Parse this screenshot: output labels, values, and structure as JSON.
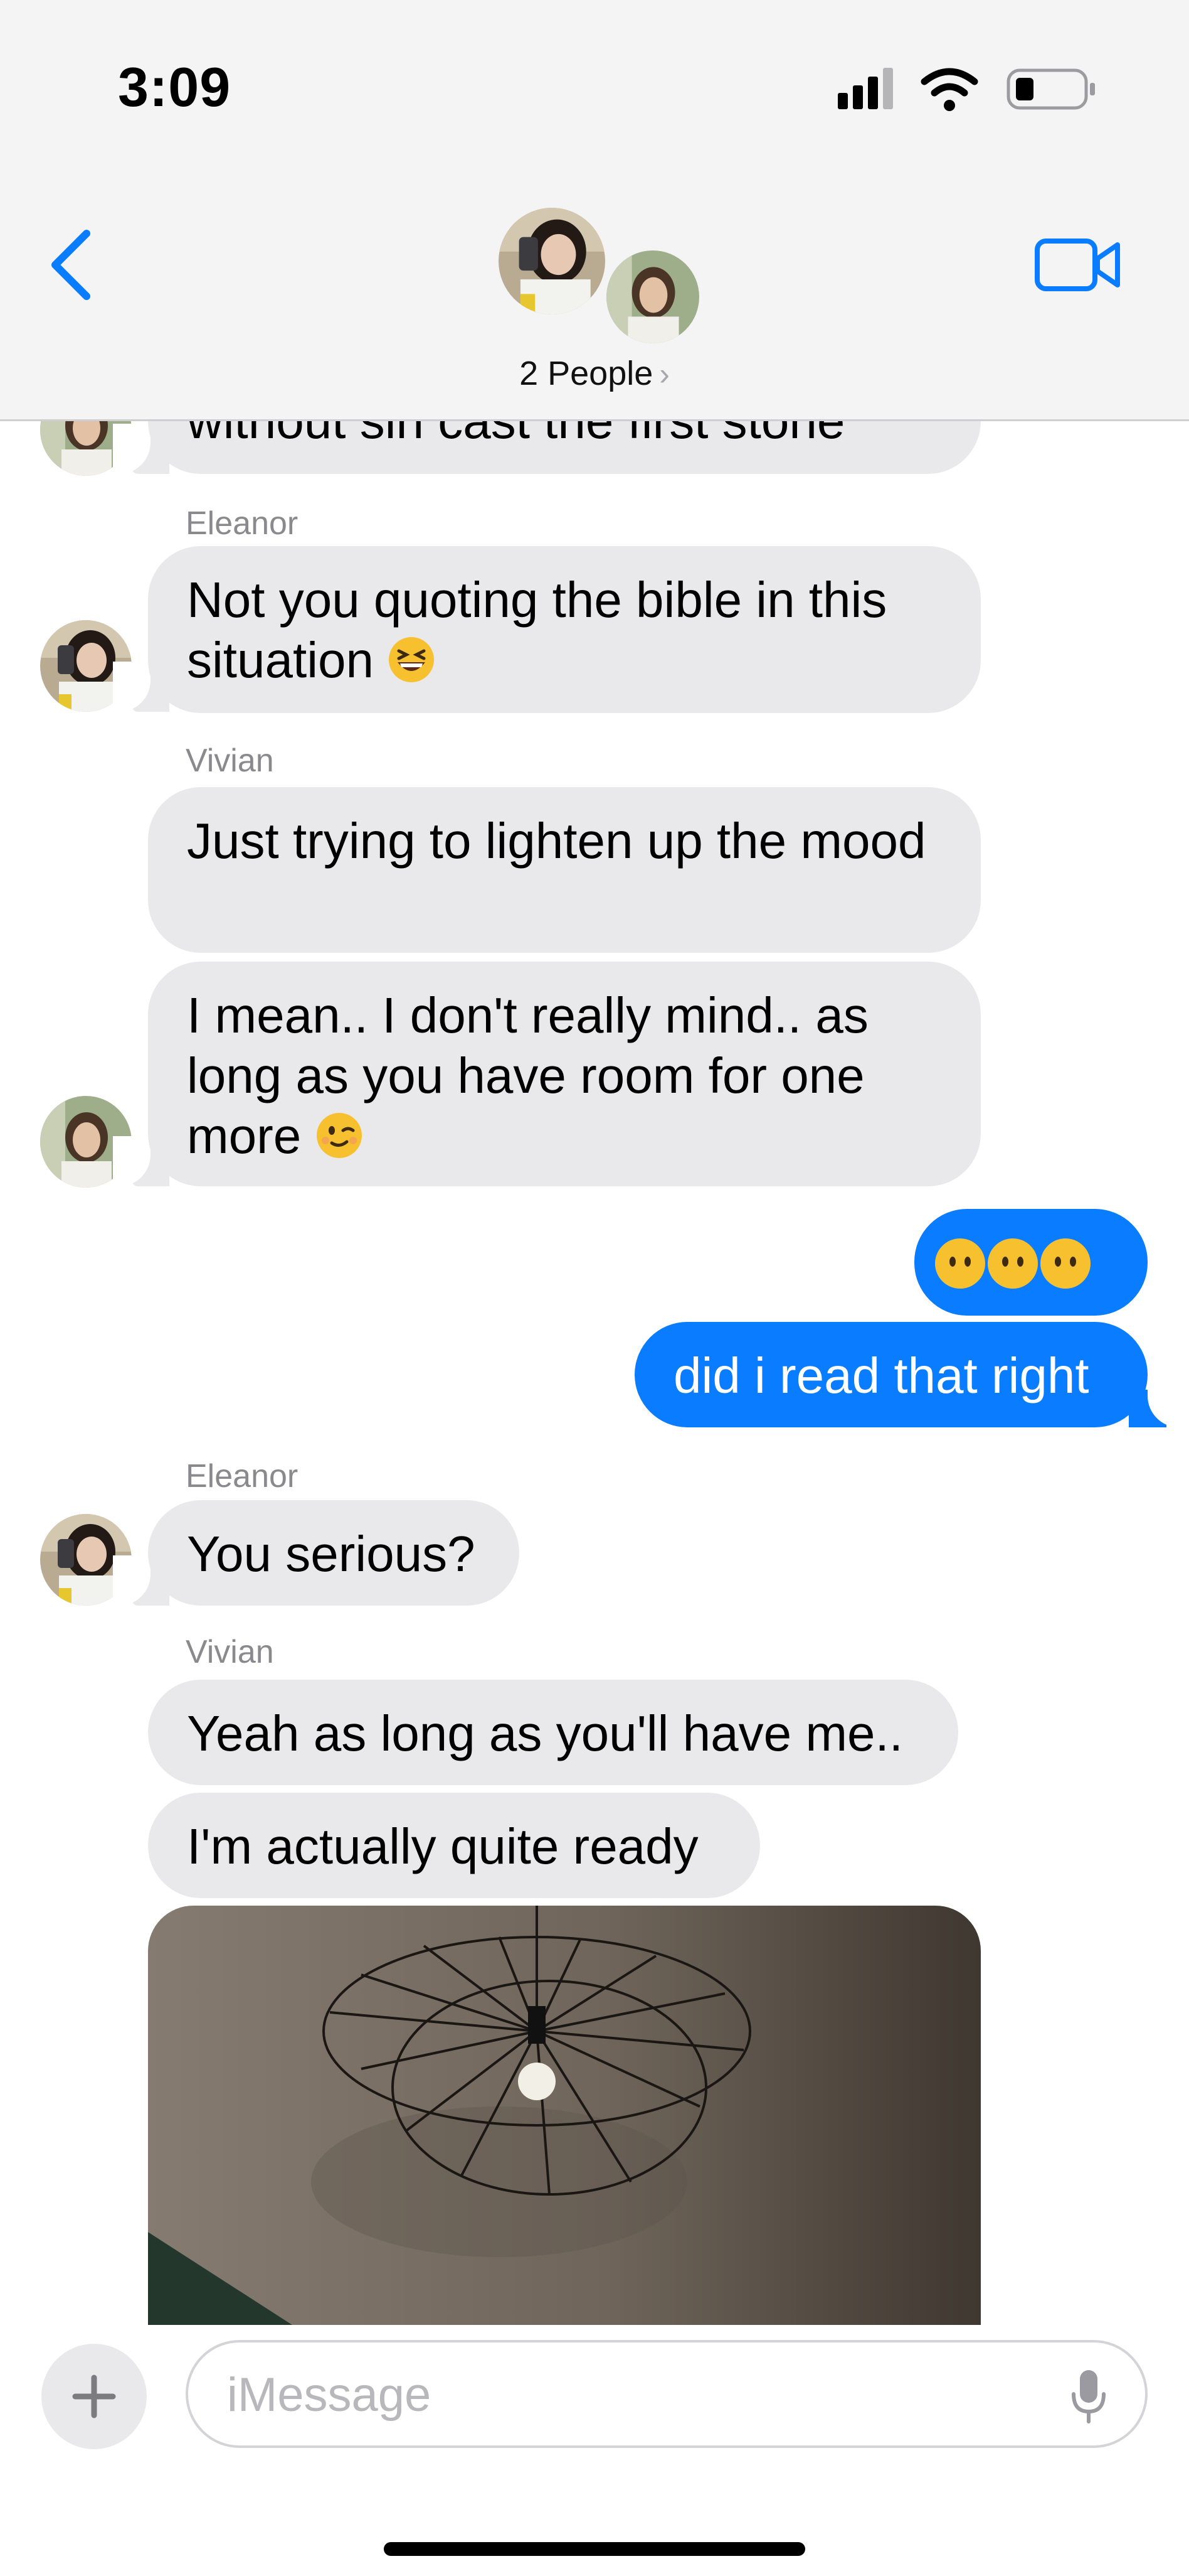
{
  "status_bar": {
    "time": "3:09"
  },
  "header": {
    "people_label": "2 People",
    "chevron": "›"
  },
  "messages": {
    "partial_top": "without sin cast the first stone",
    "m1_sender": "Eleanor",
    "m1_text": "Not you quoting the bible in this situation",
    "m2_sender": "Vivian",
    "m2_text": "Just trying to lighten up the mood",
    "m3_line1": "I mean.. I don't really mind.. as",
    "m3_line2": "long as you have room for one",
    "m3_line3": "more",
    "m4_emoji_count": 3,
    "m5_text": "did i read that right",
    "m6_sender": "Eleanor",
    "m6_text": "You serious?",
    "m7_sender": "Vivian",
    "m7_text": "Yeah as long as you'll have me..",
    "m8_text": "I'm actually quite ready"
  },
  "input": {
    "placeholder": "iMessage"
  },
  "icons": {
    "back": "chevron-left-icon",
    "video": "video-camera-icon",
    "plus": "plus-icon",
    "mic": "microphone-icon",
    "signal": "signal-icon",
    "wifi": "wifi-icon",
    "battery": "battery-icon"
  },
  "colors": {
    "accent": "#0a7cff",
    "incoming_bubble": "#e9e9eb",
    "header_bg": "#f4f4f5"
  }
}
